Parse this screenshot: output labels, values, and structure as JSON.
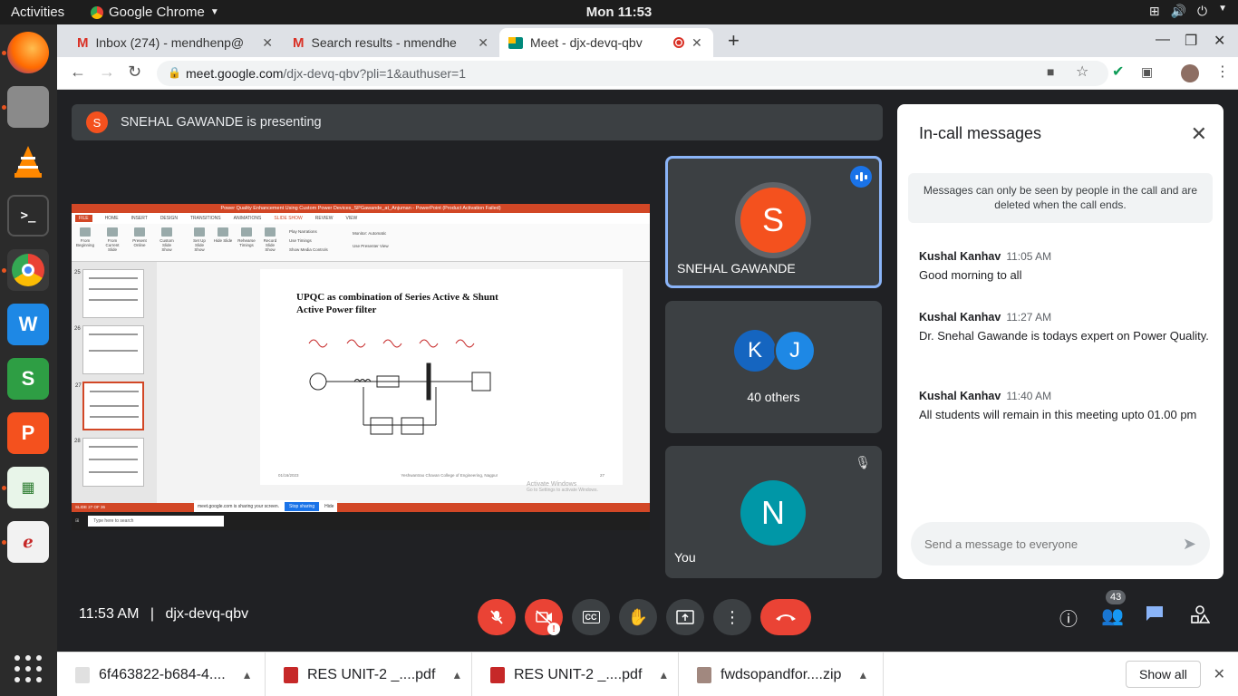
{
  "topbar": {
    "activities": "Activities",
    "app_name": "Google Chrome",
    "clock": "Mon 11:53"
  },
  "tabs": [
    {
      "title": "Inbox (274) - mendhenp@",
      "icon": "gmail-icon"
    },
    {
      "title": "Search results - nmendhe",
      "icon": "gmail-icon"
    },
    {
      "title": "Meet - djx-devq-qbv",
      "icon": "meet-icon",
      "active": true
    }
  ],
  "address": {
    "host": "meet.google.com",
    "path": "/djx-devq-qbv?pli=1&authuser=1"
  },
  "presenting_banner": {
    "initial": "S",
    "text": "SNEHAL GAWANDE is presenting"
  },
  "presentation": {
    "window_title": "Power Quality Enhancement Using Custom Power Devices_SPGawande_at_Anjuman - PowerPoint (Product Activation Failed)",
    "menu": [
      "FILE",
      "HOME",
      "INSERT",
      "DESIGN",
      "TRANSITIONS",
      "ANIMATIONS",
      "SLIDE SHOW",
      "REVIEW",
      "VIEW"
    ],
    "ribbon": [
      "From Beginning",
      "From Current Slide",
      "Present Online",
      "Custom Slide Show",
      "Set Up Slide Show",
      "Hide Slide",
      "Rehearse Timings",
      "Record Slide Show"
    ],
    "ribbon_checks": [
      "Play Narrations",
      "Use Timings",
      "Show Media Controls",
      "Monitor: Automatic",
      "Use Presenter View"
    ],
    "thumb_numbers": [
      "25",
      "26",
      "27",
      "28"
    ],
    "slide_title_line1": "UPQC  as combination of Series Active & Shunt",
    "slide_title_line2": "Active Power filter",
    "slide_footer_date": "01/16/2023",
    "slide_footer_college": "Yeshwantrao Chavan College of Engineering, Nagpur",
    "slide_footer_num": "27",
    "status": "SLIDE 27 OF 36",
    "sharing_text": "meet.google.com is sharing your screen.",
    "stop_sharing": "Stop sharing",
    "hide": "Hide",
    "task_search": "Type here to search",
    "watermark_l1": "Activate Windows",
    "watermark_l2": "Go to Settings to activate Windows."
  },
  "tiles": {
    "presenter": {
      "initial": "S",
      "name": "SNEHAL GAWANDE",
      "color": "#f4511e"
    },
    "others": {
      "initials": [
        "K",
        "J"
      ],
      "label": "40 others"
    },
    "self": {
      "initial": "N",
      "name": "You",
      "color": "#0097a7"
    }
  },
  "chat": {
    "title": "In-call messages",
    "notice": "Messages can only be seen by people in the call and are deleted when the call ends.",
    "messages": [
      {
        "sender": "Kushal Kanhav",
        "time": "11:05 AM",
        "text": "Good morning to all"
      },
      {
        "sender": "Kushal Kanhav",
        "time": "11:27 AM",
        "text": "Dr. Snehal Gawande is todays expert on Power Quality."
      },
      {
        "sender": "Kushal Kanhav",
        "time": "11:40 AM",
        "text": "All students will remain in this meeting upto 01.00 pm"
      }
    ],
    "input_placeholder": "Send a message to everyone"
  },
  "bottom": {
    "time": "11:53 AM",
    "meeting_code": "djx-devq-qbv",
    "people_count": "43"
  },
  "downloads": [
    {
      "name": "6f463822-b684-4....",
      "icon": "file-icon"
    },
    {
      "name": "RES UNIT-2 _....pdf",
      "icon": "pdf-icon"
    },
    {
      "name": "RES UNIT-2 _....pdf",
      "icon": "pdf-icon"
    },
    {
      "name": "fwdsopandfor....zip",
      "icon": "zip-icon"
    }
  ],
  "show_all": "Show all"
}
